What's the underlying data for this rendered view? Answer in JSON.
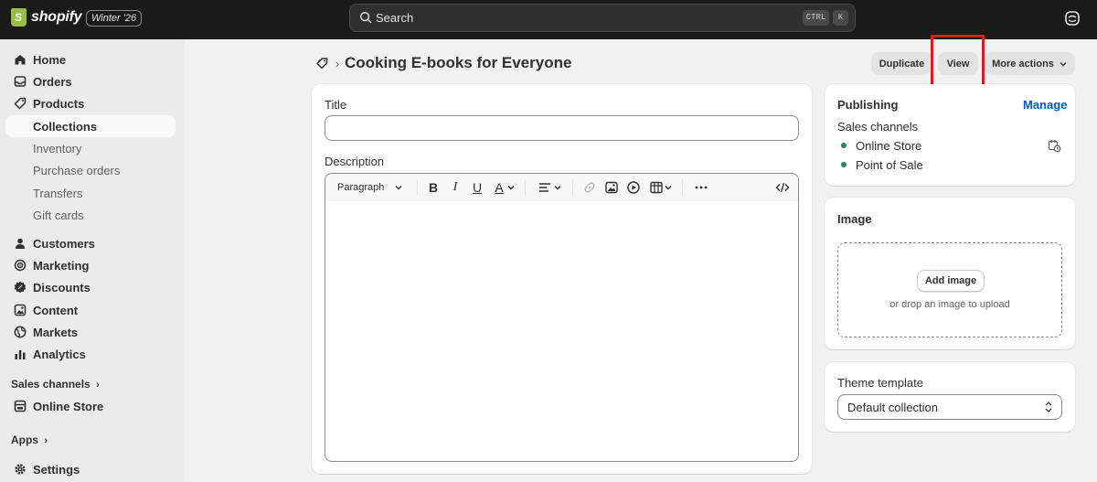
{
  "topbar": {
    "brand": "shopify",
    "edition": "Winter '26",
    "search_label": "Search",
    "kbd_ctrl": "CTRL",
    "kbd_k": "K"
  },
  "sidebar": {
    "items": [
      {
        "label": "Home",
        "icon": "home-icon"
      },
      {
        "label": "Orders",
        "icon": "inbox-icon"
      },
      {
        "label": "Products",
        "icon": "tag-icon"
      },
      {
        "label": "Collections"
      },
      {
        "label": "Inventory"
      },
      {
        "label": "Purchase orders"
      },
      {
        "label": "Transfers"
      },
      {
        "label": "Gift cards"
      },
      {
        "label": "Customers",
        "icon": "person-icon"
      },
      {
        "label": "Marketing",
        "icon": "target-icon"
      },
      {
        "label": "Discounts",
        "icon": "discount-icon"
      },
      {
        "label": "Content",
        "icon": "content-icon"
      },
      {
        "label": "Markets",
        "icon": "globe-icon"
      },
      {
        "label": "Analytics",
        "icon": "chart-icon"
      }
    ],
    "sales_channels_label": "Sales channels",
    "online_store_label": "Online Store",
    "apps_label": "Apps",
    "settings_label": "Settings"
  },
  "header": {
    "title": "Cooking E-books for Everyone",
    "duplicate_label": "Duplicate",
    "view_label": "View",
    "more_actions_label": "More actions"
  },
  "main": {
    "title_label": "Title",
    "title_value": "",
    "description_label": "Description",
    "paragraph_label": "Paragraph"
  },
  "publishing": {
    "heading": "Publishing",
    "manage_label": "Manage",
    "sales_channels_label": "Sales channels",
    "channels": [
      "Online Store",
      "Point of Sale"
    ]
  },
  "image": {
    "heading": "Image",
    "add_label": "Add image",
    "hint": "or drop an image to upload"
  },
  "theme": {
    "heading": "Theme template",
    "value": "Default collection"
  },
  "colors": {
    "accent": "#005bd3",
    "channel_active": "#29845a",
    "highlight": "#d6201c"
  }
}
